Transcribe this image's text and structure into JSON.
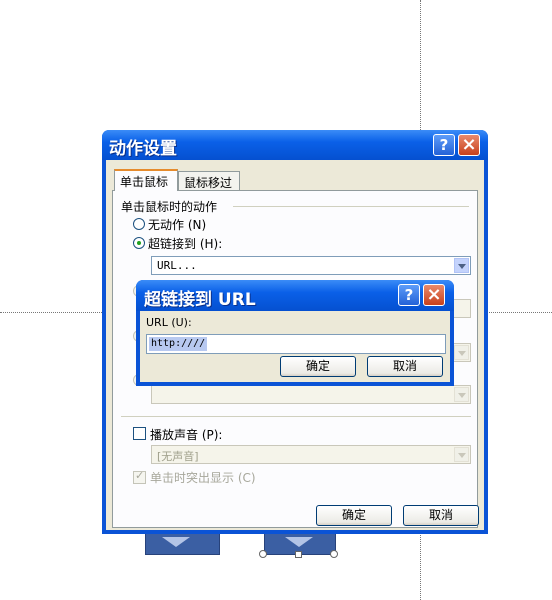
{
  "dialog": {
    "title": "动作设置",
    "help_icon": "?",
    "close_icon": "×",
    "tabs": [
      {
        "label": "单击鼠标",
        "active": true
      },
      {
        "label": "鼠标移过",
        "active": false
      }
    ],
    "action_group_label": "单击鼠标时的动作",
    "options": {
      "none": "无动作 (N)",
      "hyperlink": "超链接到 (H):"
    },
    "hyperlink_value": "URL...",
    "play_sound_label": "播放声音 (P):",
    "sound_value": "[无声音]",
    "highlight_label": "单击时突出显示 (C)",
    "ok_label": "确定",
    "cancel_label": "取消"
  },
  "url_dialog": {
    "title": "超链接到 URL",
    "help_icon": "?",
    "close_icon": "×",
    "field_label": "URL (U):",
    "url_value": "http:////",
    "ok_label": "确定",
    "cancel_label": "取消"
  },
  "colors": {
    "titlebar": "#0a53d6",
    "client": "#ece9d8",
    "close": "#c8401c"
  }
}
